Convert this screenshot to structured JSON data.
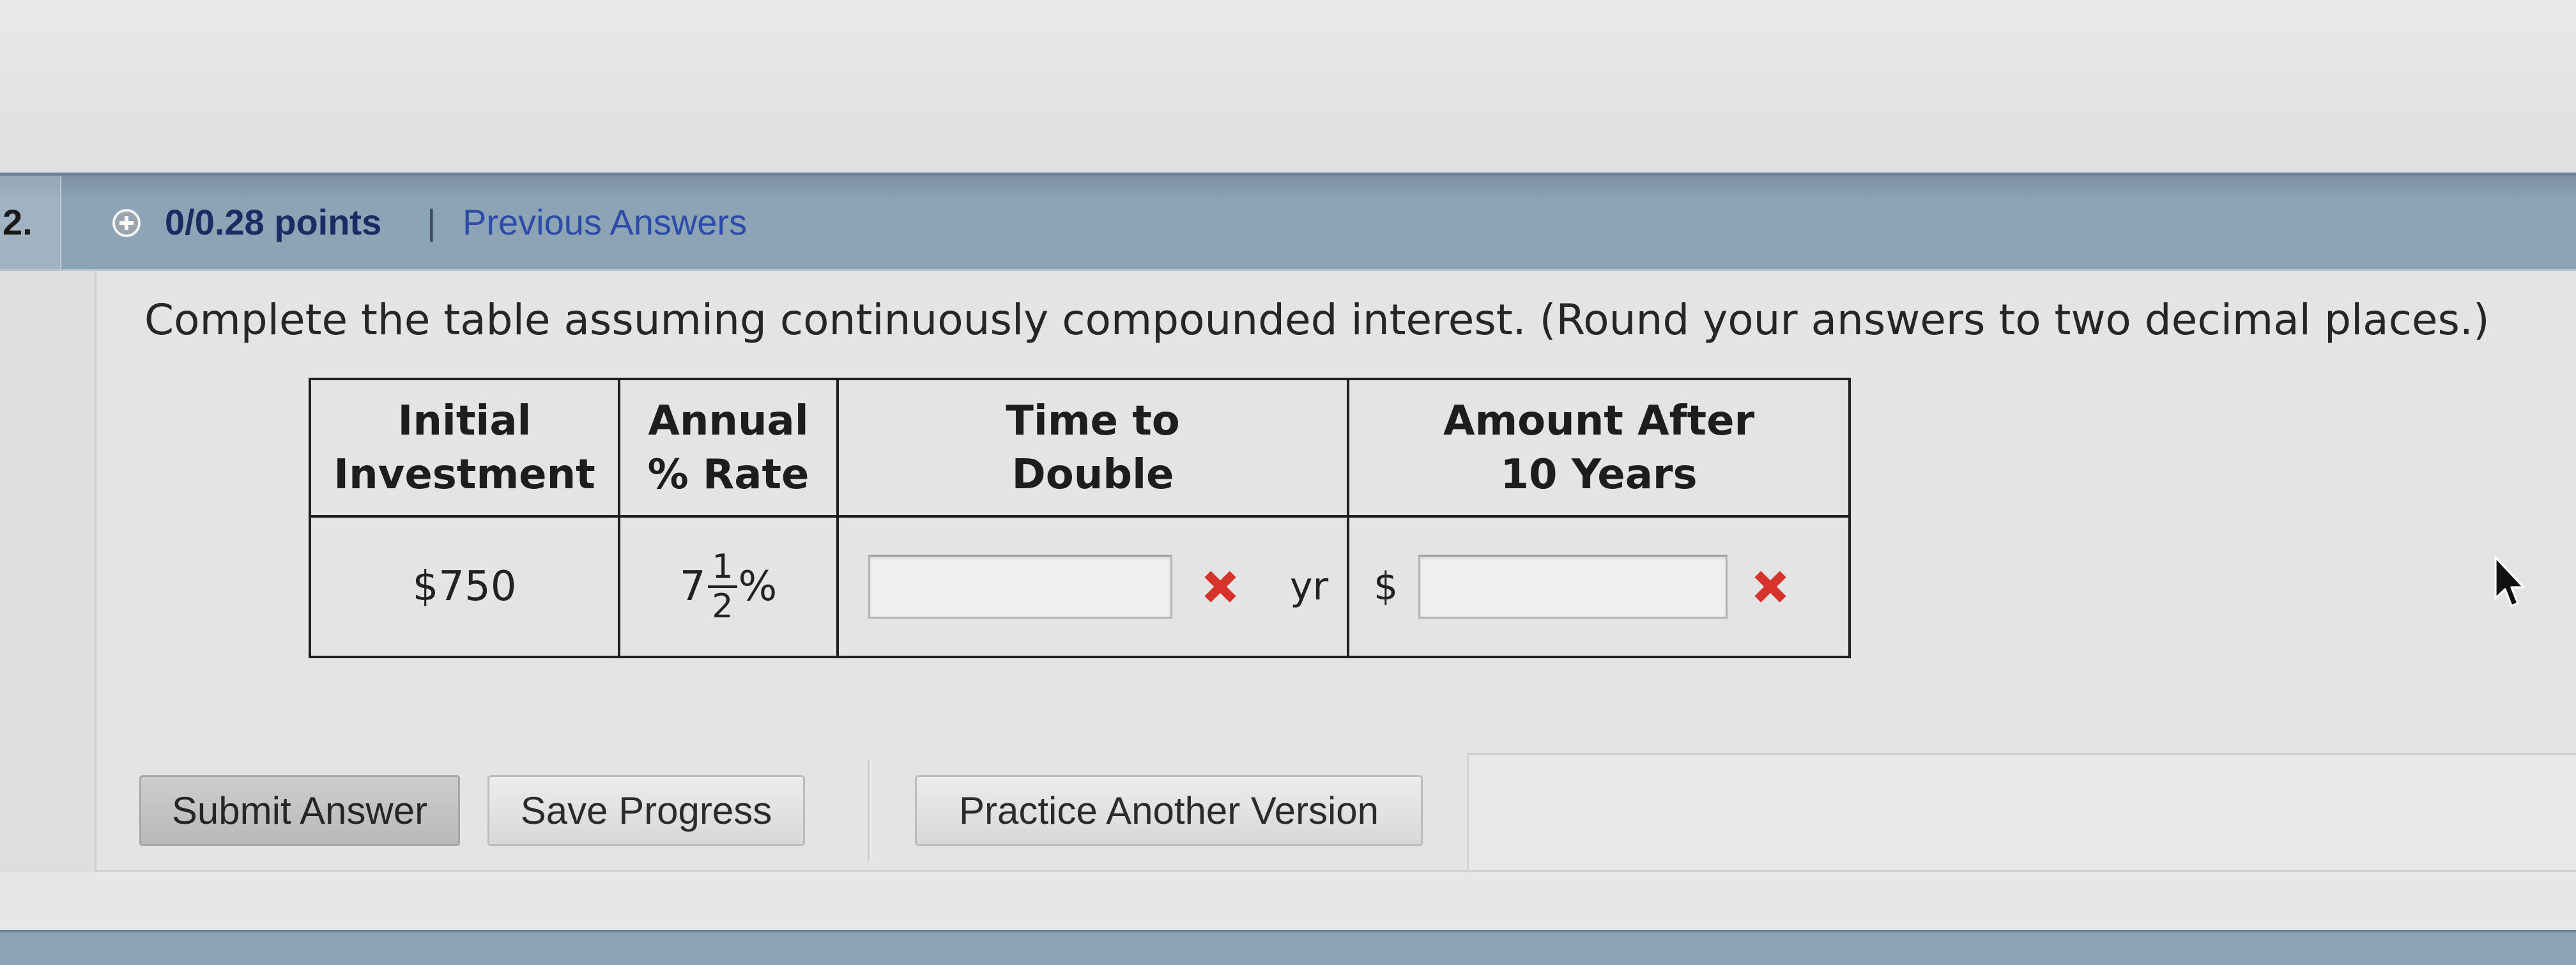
{
  "question": {
    "number": "2.",
    "points": "0/0.28 points",
    "separator": "|",
    "previous_answers": "Previous Answers",
    "prompt": "Complete the table assuming continuously compounded interest. (Round your answers to two decimal places.)"
  },
  "table": {
    "headers": [
      {
        "line1": "Initial",
        "line2": "Investment"
      },
      {
        "line1": "Annual",
        "line2": "% Rate"
      },
      {
        "line1": "Time to",
        "line2": "Double"
      },
      {
        "line1": "Amount After",
        "line2": "10 Years"
      }
    ],
    "row": {
      "initial_investment": "$750",
      "annual_rate": {
        "whole": "7",
        "numerator": "1",
        "denominator": "2",
        "unit": "%"
      },
      "time_to_double": {
        "value": "",
        "unit": "yr",
        "mark_icon": "incorrect-x-icon"
      },
      "amount_after": {
        "prefix": "$",
        "value": "",
        "mark_icon": "incorrect-x-icon"
      }
    }
  },
  "buttons": {
    "submit": "Submit Answer",
    "save": "Save Progress",
    "practice": "Practice Another Version"
  },
  "icons": {
    "points_toggle": "plus-circle-icon",
    "cursor": "mouse-pointer-icon"
  },
  "colors": {
    "header_bar": "#8da3b6",
    "points_text": "#1c2c63",
    "link": "#2d4ca8",
    "incorrect_mark": "#d6332a",
    "table_border": "#1f1f1f",
    "page_background": "#dedede"
  }
}
